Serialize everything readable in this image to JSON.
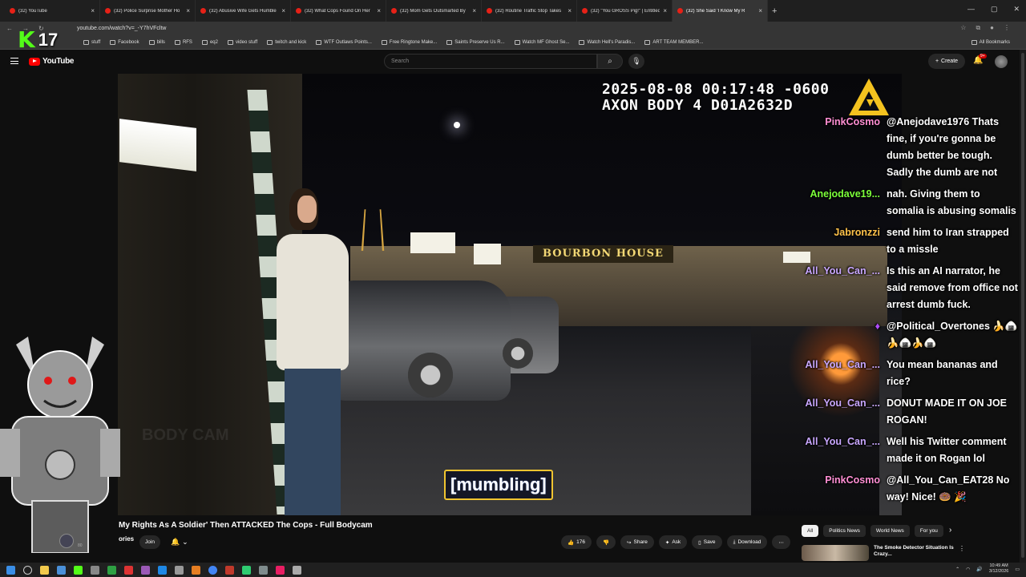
{
  "browser": {
    "tabs": [
      {
        "title": "(32) YouTube",
        "active": false
      },
      {
        "title": "(32) Police Surprise Mother Ho",
        "active": false
      },
      {
        "title": "(32) Abusive Wife Gets Humble",
        "active": false
      },
      {
        "title": "(32) What Cops Found On Her",
        "active": false
      },
      {
        "title": "(32) Mom Gets Outsmarted By",
        "active": false
      },
      {
        "title": "(32) Routine Traffic Stop Takes",
        "active": false
      },
      {
        "title": "(32) \"You GROSS Pig!\" | Entitled",
        "active": false
      },
      {
        "title": "(32) She Said 'I Know My R",
        "active": true
      }
    ],
    "new_tab": "+",
    "url": "youtube.com/watch?v=_-Y7hVFcltw",
    "bookmarks": [
      "stuff",
      "Facebook",
      "bills",
      "RFS",
      "eq2",
      "video stuff",
      "twitch and kick",
      "WTF Outlaws Points...",
      "Free Ringtone Make...",
      "Saints Preserve Us R...",
      "Watch MF Ghost Se...",
      "Watch Hell's Paradis...",
      "ART TEAM MEMBER..."
    ],
    "all_bookmarks": "All Bookmarks"
  },
  "youtube": {
    "logo_text": "YouTube",
    "search_placeholder": "Search",
    "create_label": "Create",
    "notification_count": "9+"
  },
  "video": {
    "timestamp_line1": "2025-08-08 00:17:48 -0600",
    "timestamp_line2": "AXON BODY 4 D01A2632D",
    "caption": "[mumbling]",
    "store_sign": "BOURBON HOUSE",
    "watermark": "BODY CAM"
  },
  "overlay": {
    "streamer_number": "17",
    "chat": [
      {
        "user": "PinkCosmo",
        "color": "#ff8fd4",
        "text": "@Anejodave1976 Thats fine, if you're gonna be dumb better be tough. Sadly the dumb are not"
      },
      {
        "user": "Anejodave19...",
        "color": "#7cff3a",
        "text": "nah. Giving them to somalia is abusing somalis"
      },
      {
        "user": "Jabronzzi",
        "color": "#ffc24a",
        "text": "send him to Iran strapped to a missle"
      },
      {
        "user": "All_You_Can_...",
        "color": "#c9a7ff",
        "text": "Is this an AI narrator, he said remove from office not arrest dumb fuck."
      },
      {
        "user": "",
        "color": "#b04cff",
        "text": "@Political_Overtones 🍌🍙🍌🍙🍌🍙"
      },
      {
        "user": "All_You_Can_...",
        "color": "#c9a7ff",
        "text": "You mean bananas and rice?"
      },
      {
        "user": "All_You_Can_...",
        "color": "#c9a7ff",
        "text": "DONUT MADE IT ON JOE ROGAN!"
      },
      {
        "user": "All_You_Can_...",
        "color": "#c9a7ff",
        "text": "Well his Twitter comment made it on Rogan lol"
      },
      {
        "user": "PinkCosmo",
        "color": "#ff8fd4",
        "text": "@All_You_Can_EAT28 No way! Nice! 🍩 🎉"
      }
    ]
  },
  "below": {
    "title": "My Rights As A Soldier' Then ATTACKED The Cops - Full Bodycam",
    "channel": "ories",
    "subs": "80",
    "join_label": "Join",
    "likes": "176",
    "share_label": "Share",
    "ask_label": "Ask",
    "save_label": "Save",
    "download_label": "Download",
    "chips": [
      "All",
      "Politics News",
      "World News",
      "For you"
    ],
    "rec_title": "The Smoke Detector Situation Is Crazy..."
  },
  "taskbar": {
    "time": "10:49 AM",
    "date": "3/12/2026"
  }
}
